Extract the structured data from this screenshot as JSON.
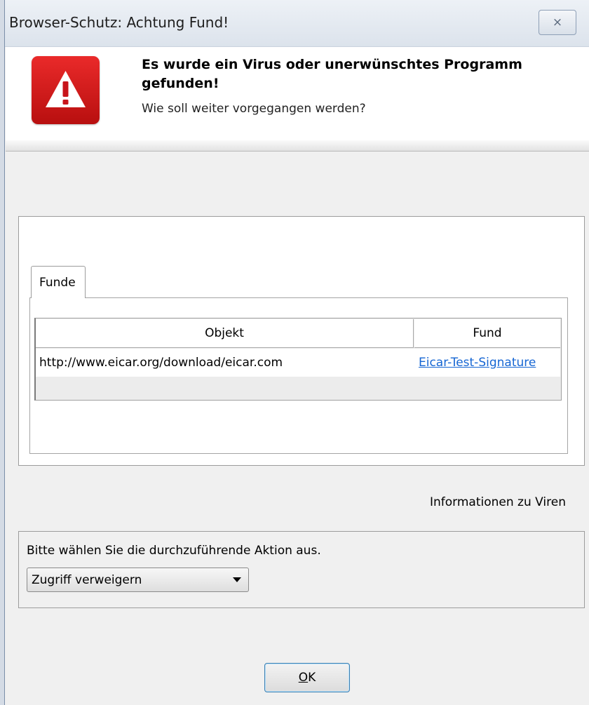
{
  "window": {
    "title": "Browser-Schutz: Achtung Fund!",
    "close_symbol": "⨯"
  },
  "header": {
    "icon": "warning-icon",
    "accent_color": "#d41a1a",
    "headline": "Es wurde ein Virus oder unerwünschtes Programm gefunden!",
    "question": "Wie soll weiter vorgegangen werden?"
  },
  "findings": {
    "tab_label": "Funde",
    "columns": [
      "Objekt",
      "Fund"
    ],
    "rows": [
      {
        "objekt": "http://www.eicar.org/download/eicar.com",
        "fund": "Eicar-Test-Signature"
      }
    ]
  },
  "info_link": "Informationen zu Viren",
  "action": {
    "label": "Bitte wählen Sie die durchzuführende Aktion aus.",
    "selected": "Zugriff verweigern"
  },
  "ok_button": {
    "prefix": "",
    "accel": "O",
    "rest": "K"
  }
}
